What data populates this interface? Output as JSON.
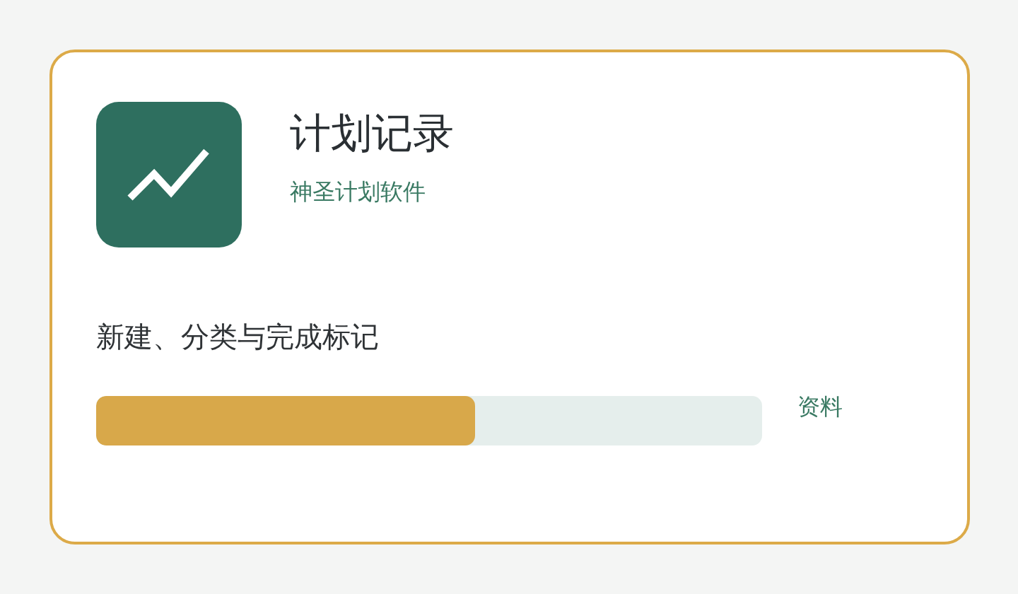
{
  "app": {
    "title": "计划记录",
    "subtitle": "神圣计划软件"
  },
  "description": "新建、分类与完成标记",
  "progress": {
    "level": 0.57
  },
  "link": "资料"
}
